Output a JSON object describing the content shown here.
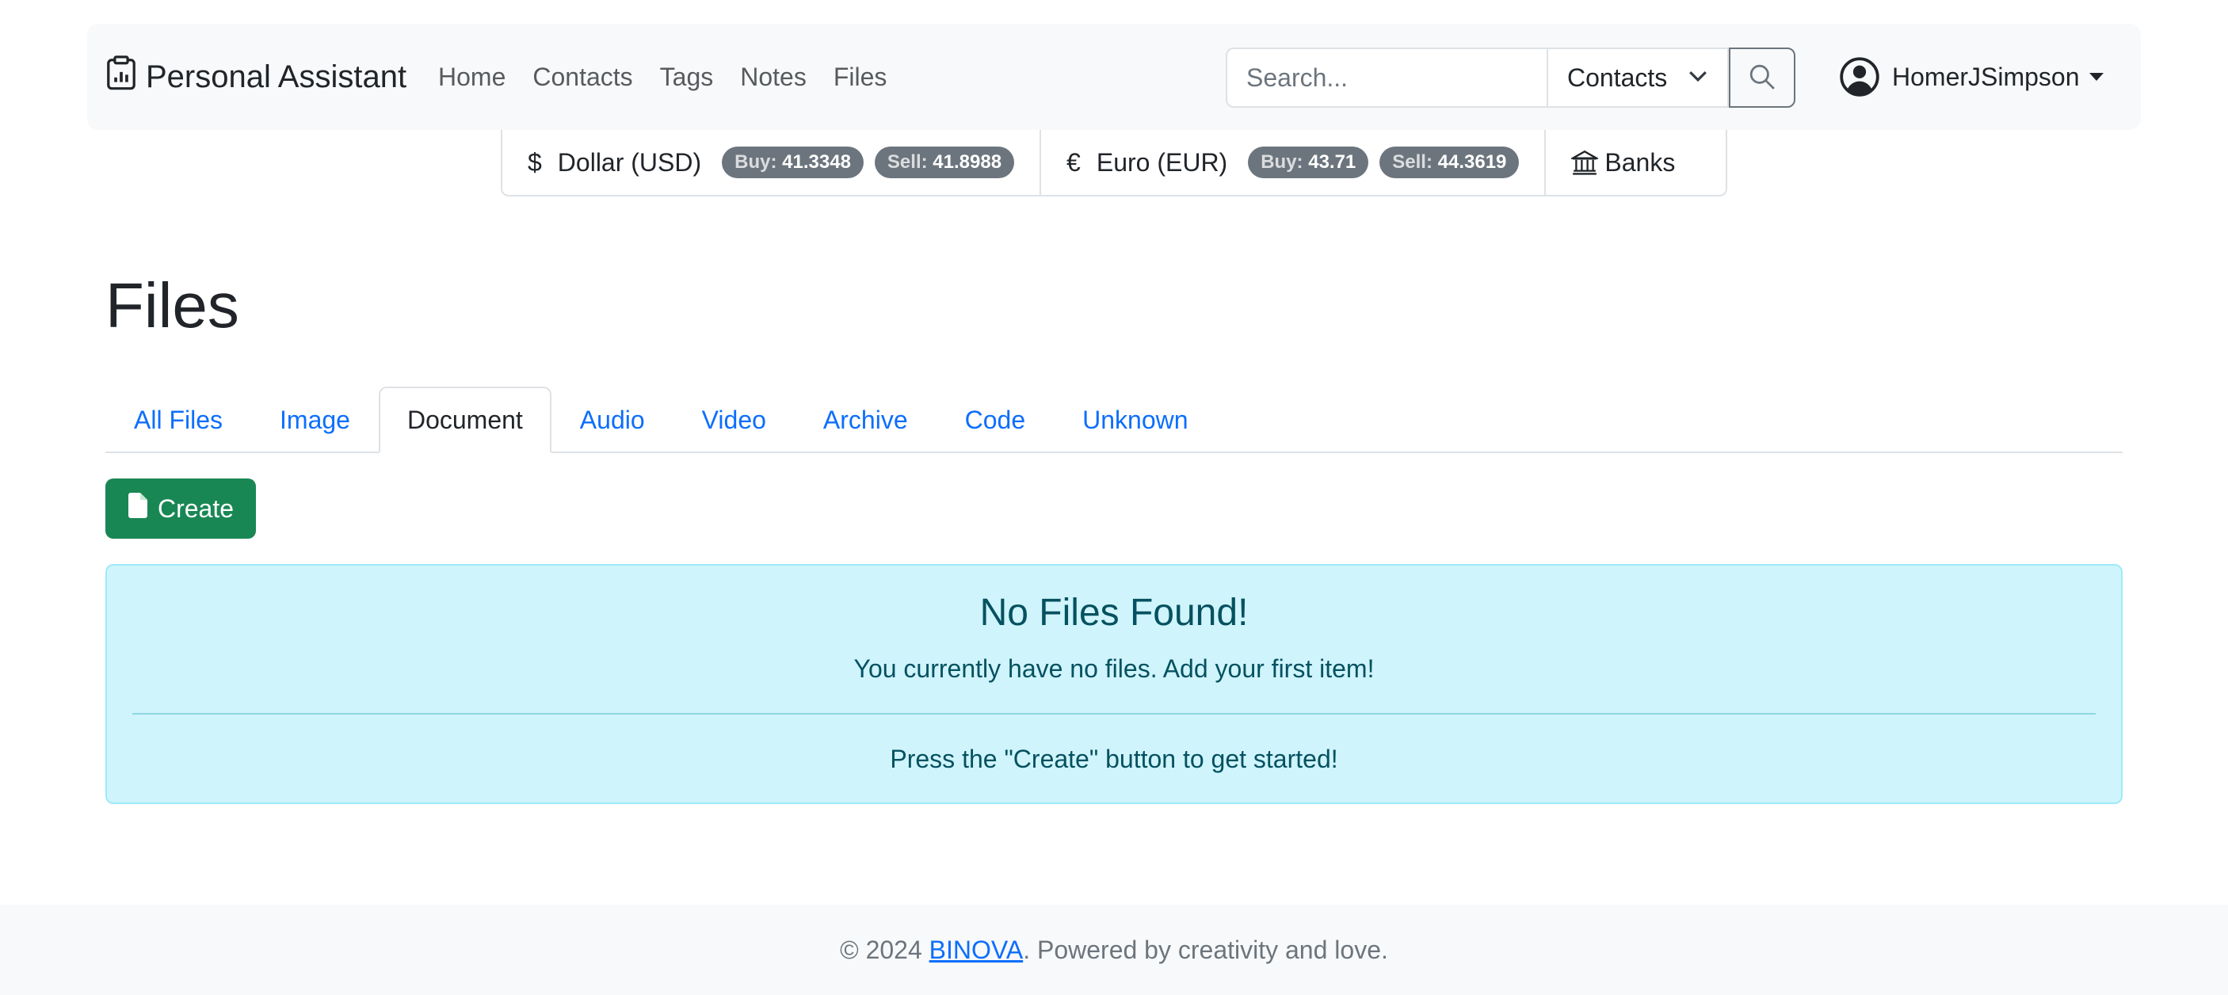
{
  "navbar": {
    "brand": "Personal Assistant",
    "links": [
      "Home",
      "Contacts",
      "Tags",
      "Notes",
      "Files"
    ],
    "search": {
      "placeholder": "Search...",
      "scope": "Contacts"
    },
    "user": "HomerJSimpson"
  },
  "currency": {
    "usd": {
      "symbol": "$",
      "name": "Dollar (USD)",
      "buy_label": "Buy:",
      "buy": "41.3348",
      "sell_label": "Sell:",
      "sell": "41.8988"
    },
    "eur": {
      "symbol": "€",
      "name": "Euro (EUR)",
      "buy_label": "Buy:",
      "buy": "43.71",
      "sell_label": "Sell:",
      "sell": "44.3619"
    },
    "banks": "Banks"
  },
  "page": {
    "title": "Files",
    "tabs": [
      {
        "label": "All Files",
        "active": false
      },
      {
        "label": "Image",
        "active": false
      },
      {
        "label": "Document",
        "active": true
      },
      {
        "label": "Audio",
        "active": false
      },
      {
        "label": "Video",
        "active": false
      },
      {
        "label": "Archive",
        "active": false
      },
      {
        "label": "Code",
        "active": false
      },
      {
        "label": "Unknown",
        "active": false
      }
    ],
    "create_label": "Create"
  },
  "alert": {
    "heading": "No Files Found!",
    "text": "You currently have no files. Add your first item!",
    "hint": "Press the \"Create\" button to get started!"
  },
  "footer": {
    "prefix": "© 2024 ",
    "link": "BINOVA",
    "suffix": ". Powered by creativity and love."
  }
}
